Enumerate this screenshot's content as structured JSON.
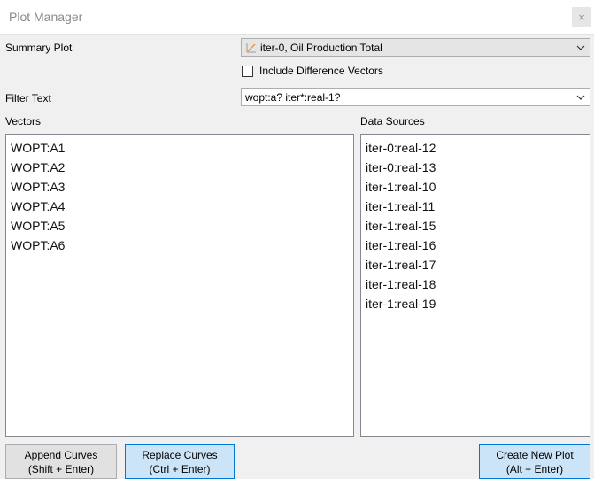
{
  "window": {
    "title": "Plot Manager",
    "close_glyph": "×"
  },
  "summary_plot": {
    "label": "Summary Plot",
    "selected": "iter-0, Oil Production Total",
    "icon": "line-plot-icon"
  },
  "include_diff": {
    "label": "Include Difference Vectors",
    "checked": false
  },
  "filter": {
    "label": "Filter Text",
    "value": "wopt:a? iter*:real-1?"
  },
  "vectors": {
    "header": "Vectors",
    "items": [
      "WOPT:A1",
      "WOPT:A2",
      "WOPT:A3",
      "WOPT:A4",
      "WOPT:A5",
      "WOPT:A6"
    ]
  },
  "data_sources": {
    "header": "Data Sources",
    "items": [
      "iter-0:real-12",
      "iter-0:real-13",
      "iter-1:real-10",
      "iter-1:real-11",
      "iter-1:real-15",
      "iter-1:real-16",
      "iter-1:real-17",
      "iter-1:real-18",
      "iter-1:real-19"
    ]
  },
  "buttons": {
    "append": {
      "line1": "Append Curves",
      "line2": "(Shift + Enter)"
    },
    "replace": {
      "line1": "Replace Curves",
      "line2": "(Ctrl + Enter)"
    },
    "create": {
      "line1": "Create New Plot",
      "line2": "(Alt + Enter)"
    }
  },
  "colors": {
    "accent": "#0078d7",
    "button_active_bg": "#cce4f7"
  }
}
